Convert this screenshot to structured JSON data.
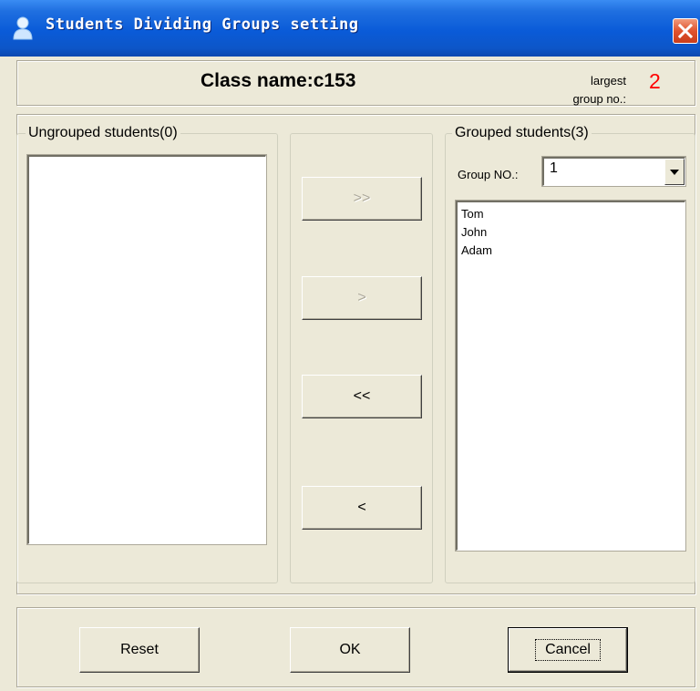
{
  "window": {
    "title": "Students Dividing Groups setting"
  },
  "header": {
    "class_name": "Class name:c153",
    "largest_group_label_line1": "largest",
    "largest_group_label_line2": "group no.:",
    "largest_group_value": "2"
  },
  "ungrouped": {
    "legend": "Ungrouped students(0)",
    "students": []
  },
  "transfer_buttons": {
    "move_all_right": ">>",
    "move_right": ">",
    "move_all_left": "<<",
    "move_left": "<"
  },
  "grouped": {
    "legend": "Grouped students(3)",
    "group_no_label": "Group NO.:",
    "group_no_value": "1",
    "students": [
      "Tom",
      "John",
      "Adam"
    ]
  },
  "footer": {
    "reset": "Reset",
    "ok": "OK",
    "cancel": "Cancel"
  },
  "colors": {
    "title_bar": "#0a5bd8",
    "window_bg": "#ece9d8",
    "largest_value": "#ff0000",
    "close_button": "#e0532e"
  }
}
